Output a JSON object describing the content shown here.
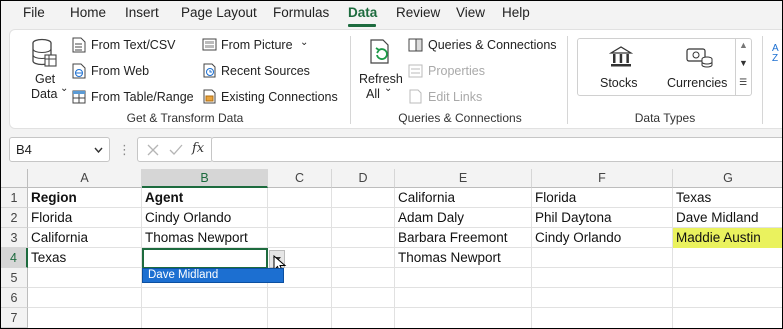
{
  "menu": {
    "tabs": [
      "File",
      "Home",
      "Insert",
      "Page Layout",
      "Formulas",
      "Data",
      "Review",
      "View",
      "Help"
    ],
    "active_tab": "Data"
  },
  "ribbon": {
    "get_data": {
      "line1": "Get",
      "line2": "Data",
      "caret": "⌄"
    },
    "get_transform": {
      "from_text_csv": "From Text/CSV",
      "from_web": "From Web",
      "from_table_range": "From Table/Range",
      "from_picture": "From Picture",
      "recent_sources": "Recent Sources",
      "existing_connections": "Existing Connections",
      "group_label": "Get & Transform Data"
    },
    "queries": {
      "refresh_line1": "Refresh",
      "refresh_line2": "All",
      "queries_connections": "Queries & Connections",
      "properties": "Properties",
      "edit_links": "Edit Links",
      "group_label": "Queries & Connections"
    },
    "data_types": {
      "stocks": "Stocks",
      "currencies": "Currencies",
      "group_label": "Data Types"
    }
  },
  "formula_bar": {
    "name_box": "B4",
    "fx": "fx",
    "formula": ""
  },
  "grid": {
    "columns": [
      "A",
      "B",
      "C",
      "D",
      "E",
      "F",
      "G"
    ],
    "rows": [
      "1",
      "2",
      "3",
      "4",
      "5",
      "6",
      "7"
    ],
    "selected_column": "B",
    "selected_row": "4",
    "cells": {
      "A1": "Region",
      "B1": "Agent",
      "A2": "Florida",
      "B2": "Cindy Orlando",
      "A3": "California",
      "B3": "Thomas Newport",
      "A4": "Texas",
      "B4": "",
      "E1": "California",
      "F1": "Florida",
      "G1": "Texas",
      "E2": "Adam Daly",
      "F2": "Phil Daytona",
      "G2": "Dave Midland",
      "E3": "Barbara Freemont",
      "F3": "Cindy Orlando",
      "G3": "Maddie Austin",
      "E4": "Thomas Newport"
    },
    "highlight_color": "#eaf25e",
    "dropdown_option": "Dave Midland"
  },
  "colors": {
    "accent": "#1d6b3e",
    "dropdown_highlight": "#1c6fd1"
  }
}
